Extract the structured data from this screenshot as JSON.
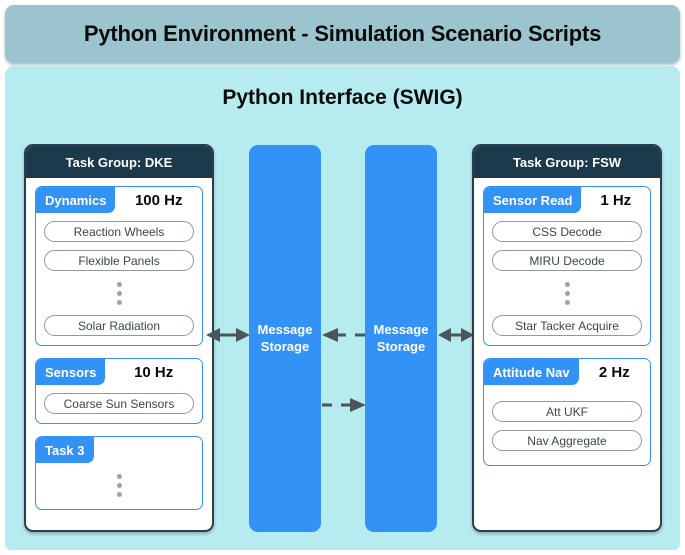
{
  "title_bar": {
    "text": "Python Environment - Simulation Scenario Scripts"
  },
  "interface": {
    "title": "Python Interface (SWIG)"
  },
  "colors": {
    "title_bar_bg": "#9cc4ce",
    "body_bg": "#b6ebef",
    "group_header_bg": "#1b3a4b",
    "accent_blue": "#3392f5",
    "pill_border": "#8e9a9d",
    "arrow": "#4a5658"
  },
  "task_groups": [
    {
      "header": "Task Group: DKE",
      "side": "left",
      "tasks": [
        {
          "name": "Dynamics",
          "rate": "100 Hz",
          "items": [
            "Reaction Wheels",
            "Flexible Panels"
          ],
          "ellipsis_after_items": true,
          "trailing_items": [
            "Solar Radiation"
          ]
        },
        {
          "name": "Sensors",
          "rate": "10 Hz",
          "items": [
            "Coarse Sun Sensors"
          ],
          "ellipsis_after_items": false,
          "trailing_items": []
        },
        {
          "name": "Task 3",
          "rate": "",
          "items": [],
          "ellipsis_after_items": true,
          "trailing_items": []
        }
      ]
    },
    {
      "header": "Task Group: FSW",
      "side": "right",
      "tasks": [
        {
          "name": "Sensor Read",
          "rate": "1 Hz",
          "items": [
            "CSS Decode",
            "MIRU Decode"
          ],
          "ellipsis_after_items": true,
          "trailing_items": [
            "Star Tacker Acquire"
          ]
        },
        {
          "name": "Attitude Nav",
          "rate": "2 Hz",
          "items": [
            "Att UKF",
            "Nav Aggregate"
          ],
          "ellipsis_after_items": false,
          "trailing_items": []
        }
      ]
    }
  ],
  "message_storage": [
    {
      "label": "Message\nStorage"
    },
    {
      "label": "Message\nStorage"
    }
  ],
  "arrows": [
    {
      "name": "left-group-to-storage",
      "style": "solid",
      "direction": "bidirectional"
    },
    {
      "name": "storage-to-storage-upper",
      "style": "dashed",
      "direction": "left"
    },
    {
      "name": "storage-to-storage-lower",
      "style": "dashed",
      "direction": "right"
    },
    {
      "name": "storage-to-right-group",
      "style": "solid",
      "direction": "bidirectional"
    }
  ]
}
